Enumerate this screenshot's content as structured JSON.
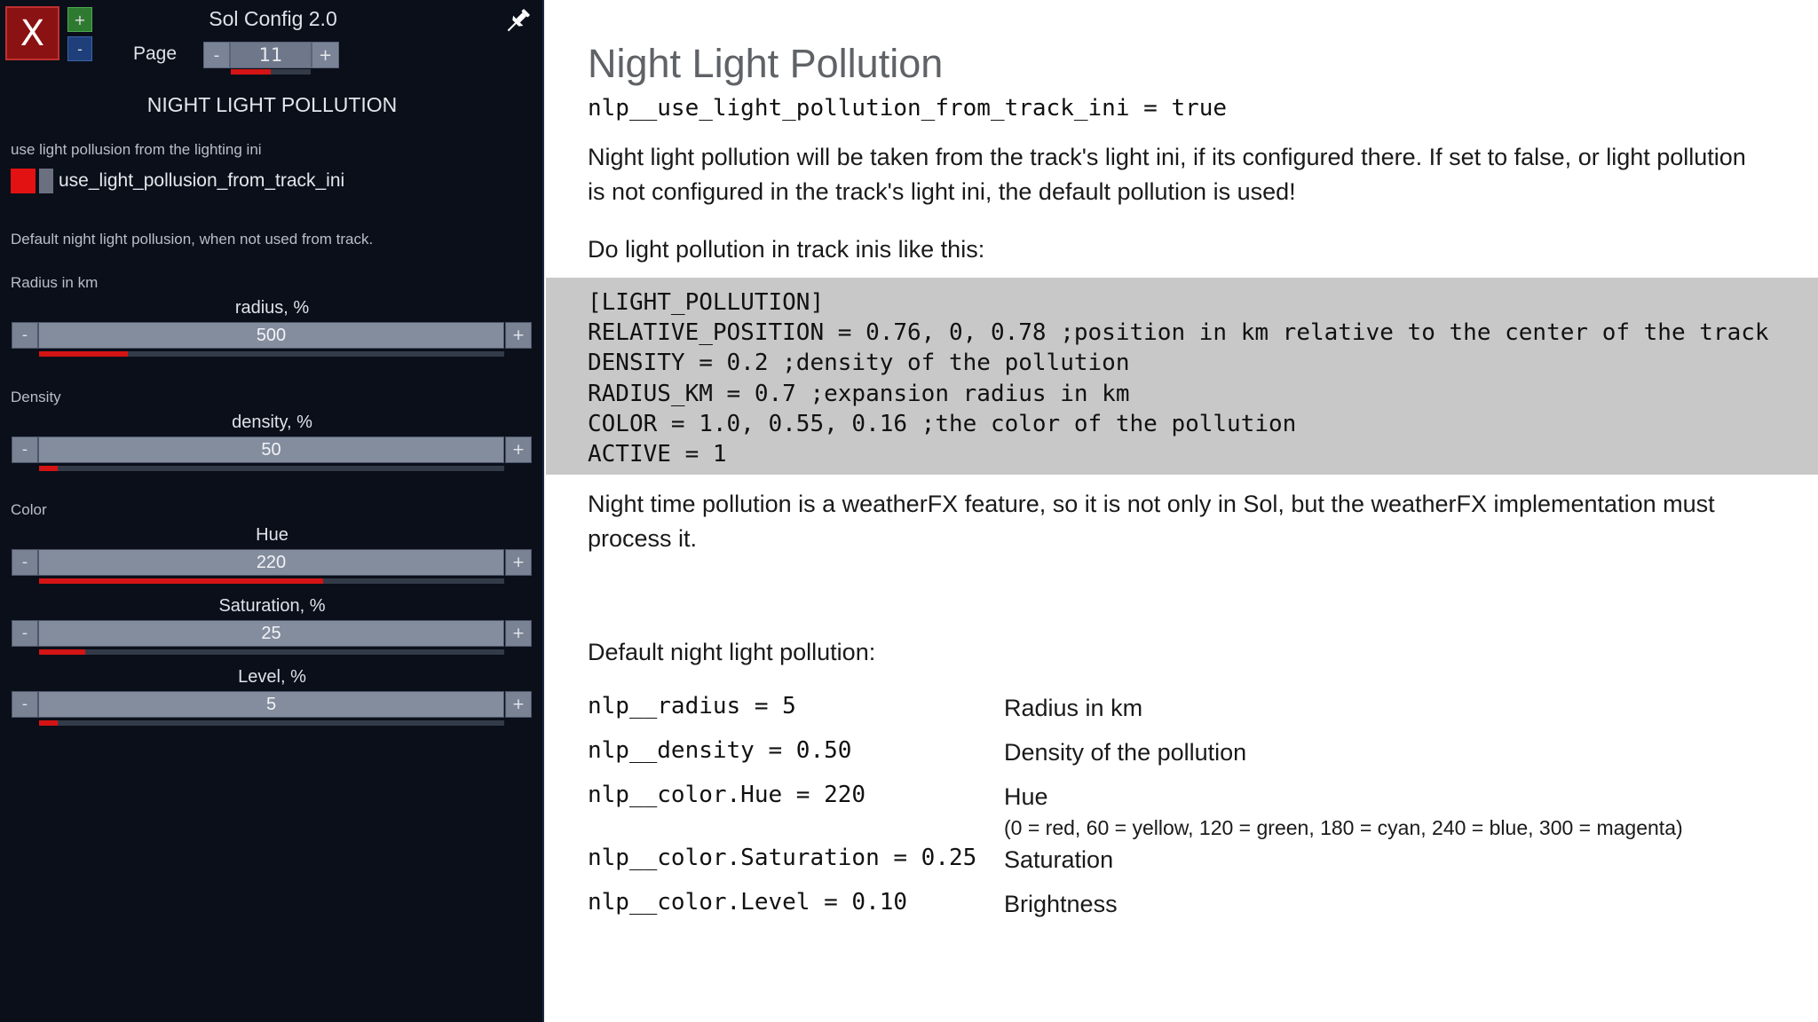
{
  "panel": {
    "close_label": "X",
    "plus_label": "+",
    "minus_label": "-",
    "app_title": "Sol Config 2.0",
    "page_label": "Page",
    "page_value": "11",
    "page_progress": 0.5,
    "section_title": "NIGHT LIGHT POLLUTION",
    "option_desc": "use light pollusion from the lighting ini",
    "checkbox_label": "use_light_pollusion_from_track_ini",
    "checkbox_checked": true,
    "default_desc": "Default night light pollusion, when not used from track.",
    "radius_group": "Radius in km",
    "density_group": "Density",
    "color_group": "Color",
    "sliders": [
      {
        "title": "radius, %",
        "value": "500",
        "fraction": 0.19
      },
      {
        "title": "density, %",
        "value": "50",
        "fraction": 0.04
      },
      {
        "title": "Hue",
        "value": "220",
        "fraction": 0.61
      },
      {
        "title": "Saturation, %",
        "value": "25",
        "fraction": 0.1
      },
      {
        "title": "Level, %",
        "value": "5",
        "fraction": 0.04
      }
    ],
    "colors": {
      "background": "#0a0f1a",
      "accent_red": "#d41414",
      "close_red": "#8b1212"
    },
    "icons": [
      "close-icon",
      "pin-icon",
      "plus-icon",
      "minus-icon"
    ]
  },
  "doc": {
    "title": "Night Light Pollution",
    "code_setting": "nlp__use_light_pollution_from_track_ini = true",
    "para1": "Night light pollution will be taken from the track's light ini, if its configured there. If set to false, or light pollution is not configured in the track's light ini, the default pollution is used!",
    "para2": "Do light pollution in track inis like this:",
    "code_block": [
      "[LIGHT_POLLUTION]",
      "RELATIVE_POSITION = 0.76, 0, 0.78 ;position in km relative to the center of the track",
      "DENSITY = 0.2 ;density of the pollution",
      "RADIUS_KM = 0.7 ;expansion radius in km",
      "COLOR = 1.0, 0.55, 0.16 ;the color of the pollution",
      "ACTIVE = 1"
    ],
    "para3": "Night time pollution is a weatherFX feature, so it is not only in Sol, but the weatherFX implementation must process it.",
    "defaults_heading": "Default night light pollution:",
    "defaults": [
      {
        "key": "nlp__radius = 5",
        "desc": "Radius in km"
      },
      {
        "key": "nlp__density = 0.50",
        "desc": "Density of the pollution"
      },
      {
        "key": "nlp__color.Hue = 220",
        "desc": "Hue"
      },
      {
        "key": "nlp__color.Saturation = 0.25",
        "desc": "Saturation"
      },
      {
        "key": "nlp__color.Level = 0.10",
        "desc": "Brightness"
      }
    ],
    "hue_note": "(0 = red, 60 = yellow, 120 = green, 180 = cyan, 240 = blue, 300 = magenta)",
    "colors": {
      "code_bg": "#c8c8c8",
      "title_gray": "#5f6266"
    }
  }
}
